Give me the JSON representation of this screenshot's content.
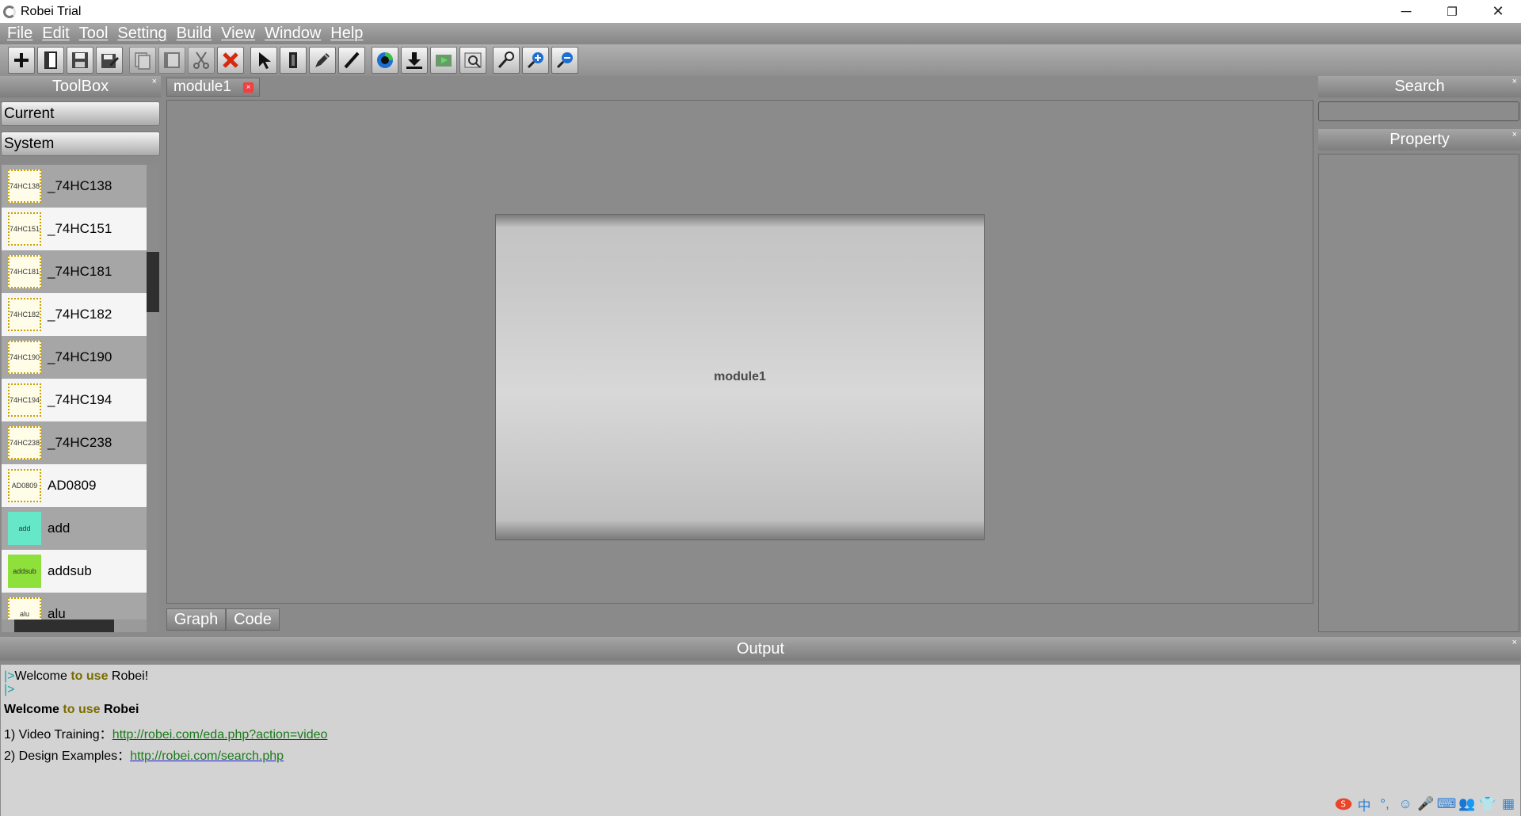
{
  "window": {
    "title": "Robei Trial",
    "minimize": "─",
    "maximize": "❐",
    "close": "✕"
  },
  "menu": [
    "File",
    "Edit",
    "Tool",
    "Setting",
    "Build",
    "View",
    "Window",
    "Help"
  ],
  "toolbar": {
    "icons": [
      "new-icon",
      "open-icon",
      "save-icon",
      "save-as-icon",
      "copy-icon",
      "paste-icon",
      "cut-icon",
      "delete-icon",
      "pointer-icon",
      "port-icon",
      "wire-pen-icon",
      "line-icon",
      "simulate-icon",
      "download-icon",
      "run-icon",
      "preview-icon",
      "zoom-icon",
      "zoom-in-icon",
      "zoom-out-icon"
    ]
  },
  "toolbox": {
    "title": "ToolBox",
    "close": "×",
    "current": "Current",
    "system": "System",
    "components": [
      {
        "name": "_74HC138",
        "icon_text": "74HC138"
      },
      {
        "name": "_74HC151",
        "icon_text": "74HC151"
      },
      {
        "name": "_74HC181",
        "icon_text": "74HC181"
      },
      {
        "name": "_74HC182",
        "icon_text": "74HC182"
      },
      {
        "name": "_74HC190",
        "icon_text": "74HC190"
      },
      {
        "name": "_74HC194",
        "icon_text": "74HC194"
      },
      {
        "name": "_74HC238",
        "icon_text": "74HC238"
      },
      {
        "name": "AD0809",
        "icon_text": "AD0809"
      },
      {
        "name": "add",
        "icon_text": "add",
        "icon_color": "#66e8c8"
      },
      {
        "name": "addsub",
        "icon_text": "addsub",
        "icon_color": "#8ee03a"
      },
      {
        "name": "alu",
        "icon_text": "alu"
      }
    ]
  },
  "editor": {
    "tab": "module1",
    "tab_close": "×",
    "module_label": "module1",
    "view_tabs": {
      "graph": "Graph",
      "code": "Code"
    }
  },
  "search": {
    "title": "Search",
    "close": "×",
    "value": ""
  },
  "property": {
    "title": "Property",
    "close": "×"
  },
  "output": {
    "title": "Output",
    "close": "×",
    "line1": {
      "prompt": "|>",
      "a": "Welcome ",
      "kw": "to use",
      "b": " Robei!"
    },
    "line2": {
      "prompt": "|>"
    },
    "line3": {
      "a": "Welcome ",
      "kw": "to use",
      "b": " Robei"
    },
    "line4": {
      "label": "1) Video Training：",
      "link": "http://robei.com/eda.php?action=video"
    },
    "line5": {
      "label": "2) Design Examples：",
      "link": "http://robei.com/search.php"
    }
  },
  "tray": {
    "ime_char": "中"
  },
  "colors": {
    "chrome": "#8a8a8a",
    "output_bg": "#d3d3d3",
    "keyword": "#7a6c00",
    "prompt": "#19a0a0",
    "link": "#1a1ad8"
  }
}
